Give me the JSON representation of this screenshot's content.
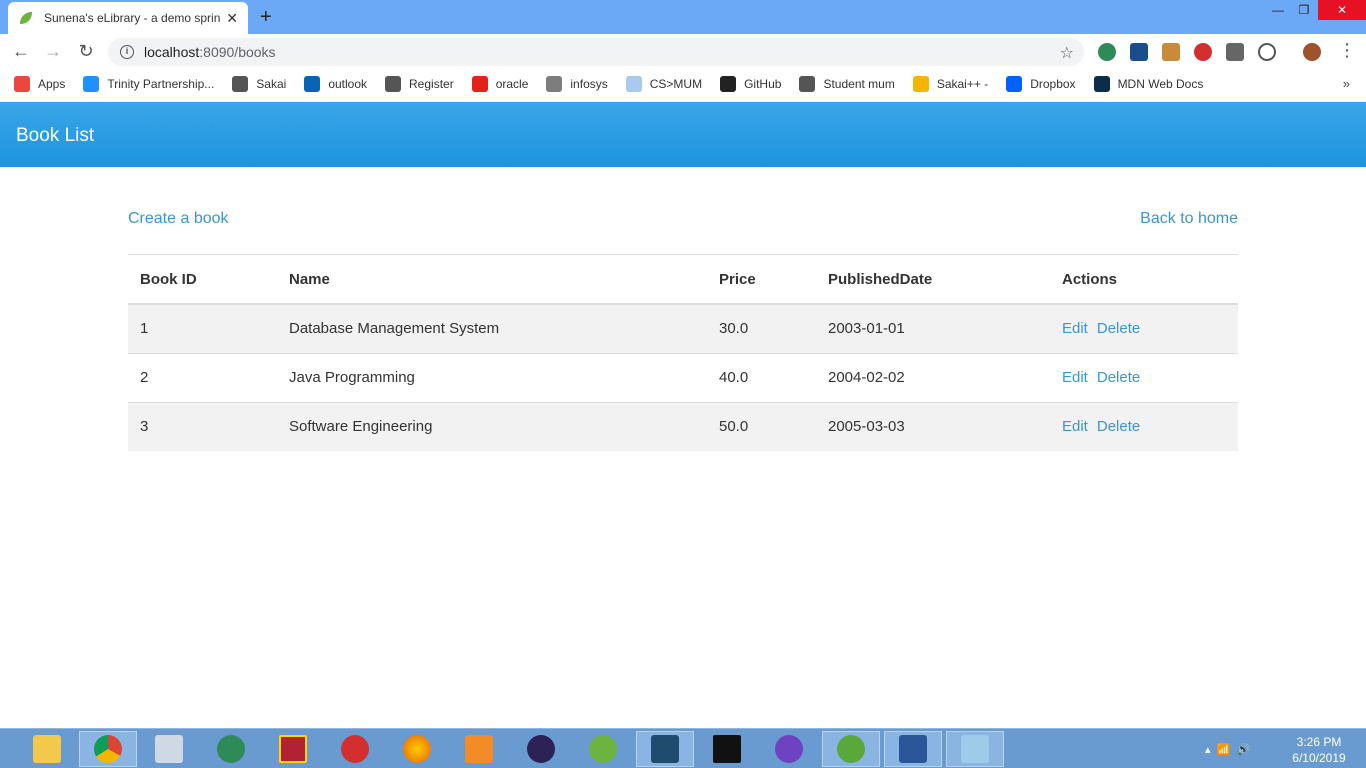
{
  "browser": {
    "tab_title": "Sunena's eLibrary - a demo sprin",
    "url_host": "localhost",
    "url_path": ":8090/books",
    "bookmarks": [
      {
        "label": "Apps",
        "color": "#e9473f"
      },
      {
        "label": "Trinity Partnership...",
        "color": "#1e90ff"
      },
      {
        "label": "Sakai",
        "color": "#555555"
      },
      {
        "label": "outlook",
        "color": "#0a64b5"
      },
      {
        "label": "Register",
        "color": "#555555"
      },
      {
        "label": "oracle",
        "color": "#e2231a"
      },
      {
        "label": "infosys",
        "color": "#7d7d7d"
      },
      {
        "label": "CS>MUM",
        "color": "#a9c9ef"
      },
      {
        "label": "GitHub",
        "color": "#222222"
      },
      {
        "label": "Student mum",
        "color": "#555555"
      },
      {
        "label": "Sakai++ -",
        "color": "#f4b400"
      },
      {
        "label": "Dropbox",
        "color": "#0061fe"
      },
      {
        "label": "MDN Web Docs",
        "color": "#0b2d4a"
      }
    ],
    "more": "»"
  },
  "app": {
    "title": "Book List",
    "ghost_links": "Create a bookBack to home"
  },
  "page": {
    "create_link": "Create a book",
    "back_link": "Back to home"
  },
  "table": {
    "headers": [
      "Book ID",
      "Name",
      "Price",
      "PublishedDate",
      "Actions"
    ],
    "rows": [
      {
        "id": "1",
        "name": "Database Management System",
        "price": "30.0",
        "date": "2003-01-01",
        "edit": "Edit",
        "delete": "Delete"
      },
      {
        "id": "2",
        "name": "Java Programming",
        "price": "40.0",
        "date": "2004-02-02",
        "edit": "Edit",
        "delete": "Delete"
      },
      {
        "id": "3",
        "name": "Software Engineering",
        "price": "50.0",
        "date": "2005-03-03",
        "edit": "Edit",
        "delete": "Delete"
      }
    ]
  },
  "taskbar": {
    "time": "3:26 PM",
    "date": "6/10/2019"
  },
  "colors": {
    "accent": "#1c94e0",
    "link": "#3a95d6"
  }
}
